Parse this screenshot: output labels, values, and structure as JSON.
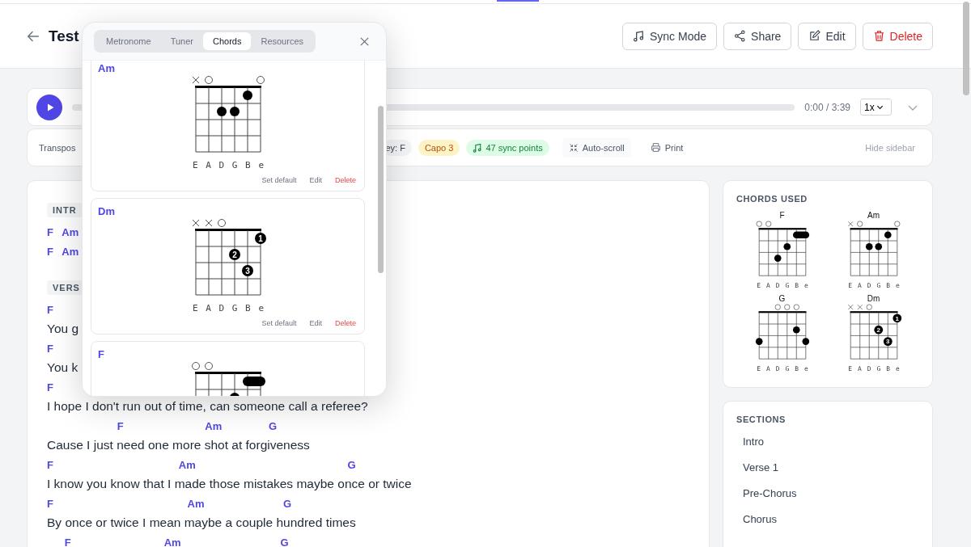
{
  "header": {
    "title": "Test",
    "buttons": [
      {
        "label": "Sync Mode",
        "kind": "sync"
      },
      {
        "label": "Share",
        "kind": "share"
      },
      {
        "label": "Edit",
        "kind": "edit"
      },
      {
        "label": "Delete",
        "kind": "delete"
      }
    ]
  },
  "player": {
    "time": "0:00 / 3:39",
    "speed": "1x"
  },
  "toolbar": {
    "transpose_label": "Transpos",
    "key": "ey: F",
    "capo": "Capo 3",
    "sync_points": "47 sync points",
    "auto_scroll": "Auto-scroll",
    "print": "Print",
    "hide_sidebar": "Hide sidebar"
  },
  "lyrics": [
    {
      "label": "INTR",
      "lines": [
        {
          "chords": "F   Am"
        },
        {
          "chords": "F   Am"
        }
      ]
    },
    {
      "label": "VERS",
      "lines": [
        {
          "chords": "F",
          "lyric": "You g"
        },
        {
          "chords": "F",
          "lyric": "You k"
        },
        {
          "chords": "F",
          "lyric": "I hope I don't run out of time, can someone call a referee?"
        },
        {
          "chords": "                        F                            Am                G",
          "lyric": "Cause I just need one more shot at forgiveness"
        },
        {
          "chords": "F                                           Am                                                    G",
          "lyric": "I know you know that I made those mistakes maybe once or twice"
        },
        {
          "chords": "F                                              Am                           G",
          "lyric": "By once or twice I mean maybe a couple hundred times"
        },
        {
          "chords": "      F                                Am                                  G"
        }
      ]
    }
  ],
  "chords_used": {
    "title": "CHORDS USED",
    "chords": [
      {
        "name": "F",
        "diagram": {
          "kind": "fmajor",
          "string_labels": "E A D G B e"
        }
      },
      {
        "name": "Am",
        "diagram": {
          "kind": "aminor",
          "string_labels": "E A D G B e"
        }
      },
      {
        "name": "G",
        "diagram": {
          "kind": "gmajor",
          "string_labels": "E A D G B e"
        }
      },
      {
        "name": "Dm",
        "diagram": {
          "kind": "dminor",
          "fingers": [
            "1",
            "2",
            "3"
          ],
          "string_labels": "E A D G B e"
        }
      }
    ]
  },
  "sections": {
    "title": "SECTIONS",
    "items": [
      "Intro",
      "Verse 1",
      "Pre-Chorus",
      "Chorus"
    ]
  },
  "popup": {
    "tabs": [
      {
        "label": "Metronome",
        "selected": false
      },
      {
        "label": "Tuner",
        "selected": false
      },
      {
        "label": "Chords",
        "selected": true
      },
      {
        "label": "Resources",
        "selected": false
      }
    ],
    "chords": [
      {
        "name": "Am",
        "diagram": {
          "kind": "aminor",
          "string_labels": "E A D G B e"
        },
        "actions": [
          {
            "label": "Set default",
            "kind": "default"
          },
          {
            "label": "Edit",
            "kind": "edit"
          },
          {
            "label": "Delete",
            "kind": "delete"
          }
        ]
      },
      {
        "name": "Dm",
        "diagram": {
          "kind": "dminor",
          "fingers": [
            "1",
            "2",
            "3"
          ],
          "string_labels": "E A D G B e"
        },
        "actions": [
          {
            "label": "Set default",
            "kind": "default"
          },
          {
            "label": "Edit",
            "kind": "edit"
          },
          {
            "label": "Delete",
            "kind": "delete"
          }
        ]
      },
      {
        "name": "F",
        "diagram": {
          "kind": "fmajor"
        }
      }
    ]
  }
}
